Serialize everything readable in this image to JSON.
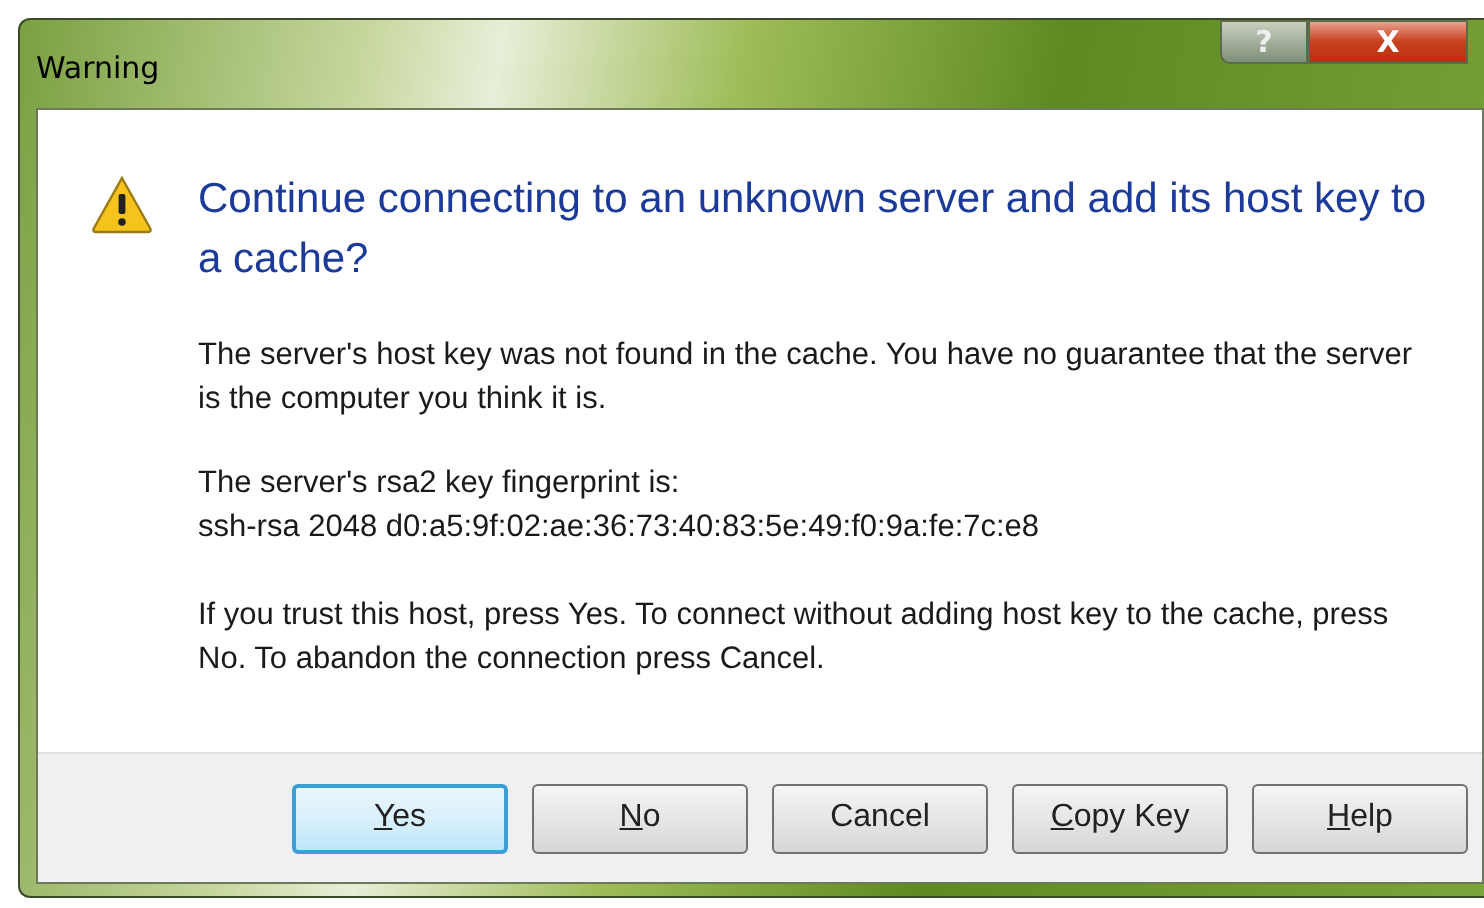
{
  "window": {
    "title": "Warning"
  },
  "title_buttons": [
    {
      "kind": "help",
      "label": "?"
    },
    {
      "kind": "close",
      "label": "X"
    }
  ],
  "heading": "Continue connecting to an unknown server and add its host key to a cache?",
  "paragraphs": [
    "The server's host key was not found in the cache. You have no guarantee that the server is the computer you think it is.",
    "The server's rsa2 key fingerprint is:",
    "ssh-rsa 2048 d0:a5:9f:02:ae:36:73:40:83:5e:49:f0:9a:fe:7c:e8",
    "If you trust this host, press Yes. To connect without adding host key to the cache, press No. To abandon the connection press Cancel."
  ],
  "buttons": [
    {
      "label": "Yes",
      "underline_first": true,
      "default": true
    },
    {
      "label": "No",
      "underline_first": true,
      "default": false
    },
    {
      "label": "Cancel",
      "underline_first": false,
      "default": false
    },
    {
      "label": "Copy Key",
      "underline_first": true,
      "default": false
    },
    {
      "label": "Help",
      "underline_first": true,
      "default": false
    }
  ]
}
